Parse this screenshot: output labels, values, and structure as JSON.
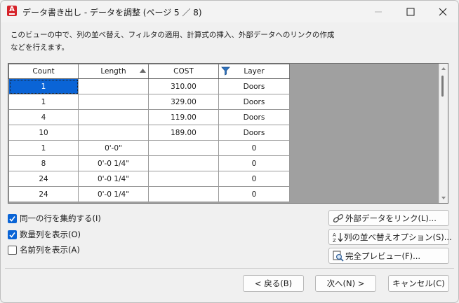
{
  "window": {
    "title": "データ書き出し - データを調整 (ページ 5 ／ 8)",
    "app_icon_letter": "A"
  },
  "description": {
    "line1": "このビューの中で、列の並べ替え、フィルタの適用、計算式の挿入、外部データへのリンクの作成",
    "line2": "などを行えます。"
  },
  "grid": {
    "columns": [
      {
        "label": "Count"
      },
      {
        "label": "Length",
        "sorted": "ascending"
      },
      {
        "label": "COST"
      },
      {
        "label": "Layer",
        "filtered": true
      }
    ],
    "rows": [
      {
        "count": "1",
        "length": "",
        "cost": "310.00",
        "layer": "Doors",
        "selected": true
      },
      {
        "count": "1",
        "length": "",
        "cost": "329.00",
        "layer": "Doors"
      },
      {
        "count": "4",
        "length": "",
        "cost": "119.00",
        "layer": "Doors"
      },
      {
        "count": "10",
        "length": "",
        "cost": "189.00",
        "layer": "Doors"
      },
      {
        "count": "1",
        "length": "0'-0\"",
        "cost": "",
        "layer": "0"
      },
      {
        "count": "8",
        "length": "0'-0 1/4\"",
        "cost": "",
        "layer": "0"
      },
      {
        "count": "24",
        "length": "0'-0 1/4\"",
        "cost": "",
        "layer": "0"
      },
      {
        "count": "24",
        "length": "0'-0 1/4\"",
        "cost": "",
        "layer": "0"
      }
    ]
  },
  "options": {
    "combine_rows": {
      "label": "同一の行を集約する(I)",
      "checked": true
    },
    "show_count": {
      "label": "数量列を表示(O)",
      "checked": true
    },
    "show_name": {
      "label": "名前列を表示(A)",
      "checked": false
    }
  },
  "buttons": {
    "link_external": "外部データをリンク(L)...",
    "sort_options": "列の並べ替えオプション(S)...",
    "full_preview": "完全プレビュー(F)...",
    "back": "< 戻る(B)",
    "next": "次へ(N) >",
    "cancel": "キャンセル(C)"
  },
  "colors": {
    "accent": "#0a64d6",
    "app_icon": "#d6232a",
    "grid_background": "#a0a0a0"
  }
}
